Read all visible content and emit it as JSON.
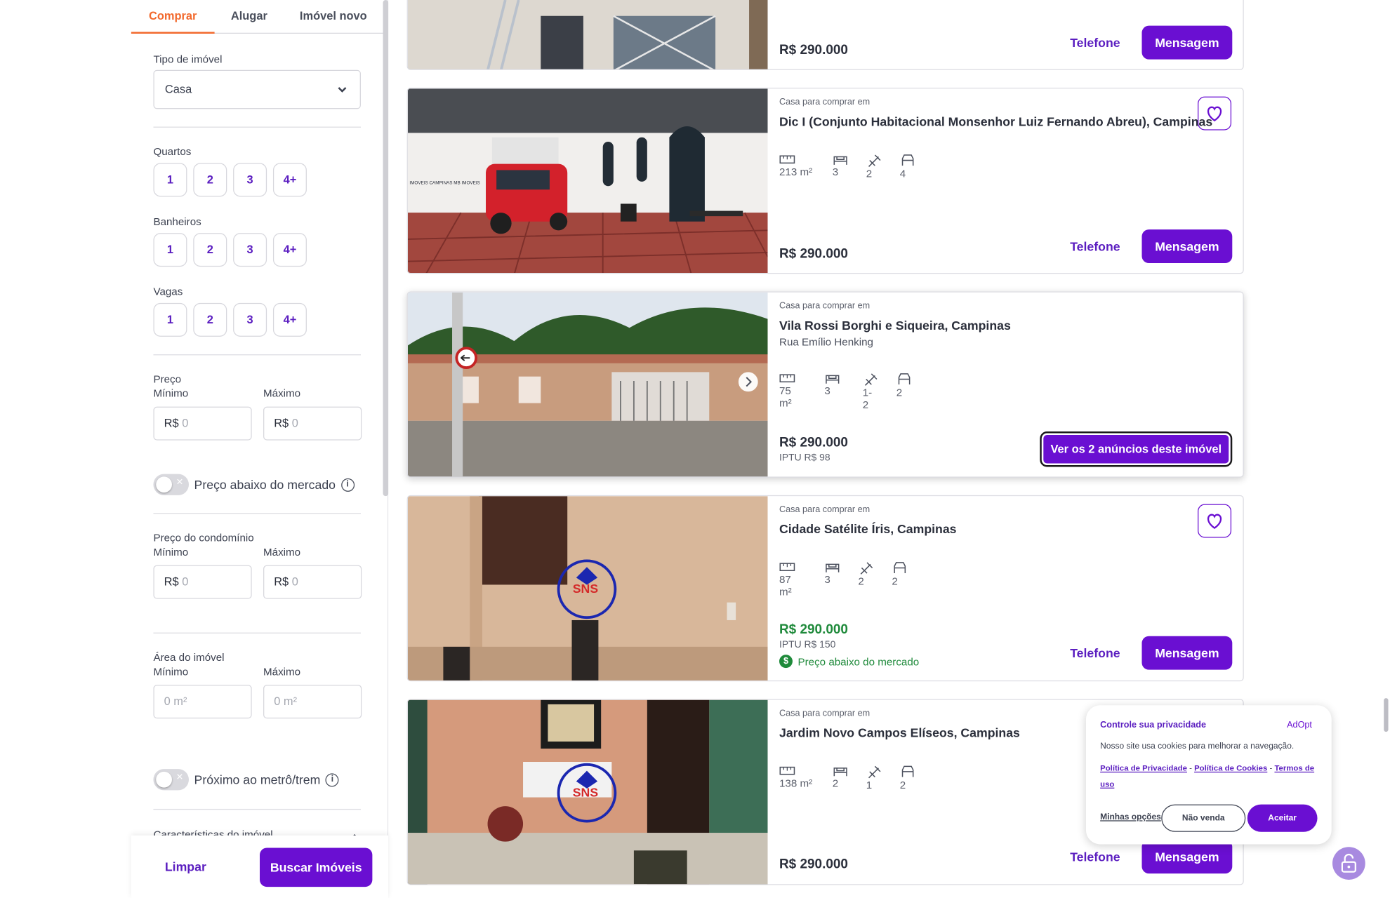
{
  "tabs": [
    {
      "label": "Comprar"
    },
    {
      "label": "Alugar"
    },
    {
      "label": "Imóvel novo"
    }
  ],
  "filters": {
    "property_type_label": "Tipo de imóvel",
    "property_type_value": "Casa",
    "bedrooms_label": "Quartos",
    "bathrooms_label": "Banheiros",
    "parking_label": "Vagas",
    "chip_options": [
      "1",
      "2",
      "3",
      "4+"
    ],
    "price_label": "Preço",
    "min_label": "Mínimo",
    "max_label": "Máximo",
    "currency_prefix": "R$",
    "price_placeholder": "0",
    "below_market_label": "Preço abaixo do mercado",
    "condo_label": "Preço do condomínio",
    "area_label": "Área do imóvel",
    "area_placeholder": "0 m²",
    "metro_label": "Próximo ao metrô/trem",
    "features_label": "Características do imóvel"
  },
  "footer": {
    "clear_label": "Limpar",
    "search_label": "Buscar Imóveis"
  },
  "listings": [
    {
      "price": "R$ 290.000",
      "phone_label": "Telefone",
      "message_label": "Mensagem"
    },
    {
      "kicker": "Casa para comprar em",
      "title": "Dic I (Conjunto Habitacional Monsenhor Luiz Fernando Abreu), Campinas",
      "area": "213 m²",
      "bedrooms": "3",
      "bathrooms": "2",
      "parking": "4",
      "price": "R$ 290.000",
      "phone_label": "Telefone",
      "message_label": "Mensagem",
      "photo_watermark": "IMOVEIS CAMPINAS MB IMOVEIS"
    },
    {
      "kicker": "Casa para comprar em",
      "title": "Vila Rossi Borghi e Siqueira, Campinas",
      "street": "Rua Emílio Henking",
      "area": "75 m²",
      "bedrooms": "3",
      "bathrooms": "1-2",
      "parking": "2",
      "price": "R$ 290.000",
      "iptu": "IPTU R$ 98",
      "cta_label": "Ver os 2 anúncios deste imóvel"
    },
    {
      "kicker": "Casa para comprar em",
      "title": "Cidade Satélite Íris, Campinas",
      "area": "87 m²",
      "bedrooms": "3",
      "bathrooms": "2",
      "parking": "2",
      "price": "R$ 290.000",
      "iptu": "IPTU R$ 150",
      "below_market": "Preço abaixo do mercado",
      "phone_label": "Telefone",
      "message_label": "Mensagem",
      "photo_logo": "SNS"
    },
    {
      "kicker": "Casa para comprar em",
      "title": "Jardim Novo Campos Elíseos, Campinas",
      "area": "138 m²",
      "bedrooms": "2",
      "bathrooms": "1",
      "parking": "2",
      "price": "R$ 290.000",
      "phone_label": "Telefone",
      "message_label": "Mensagem",
      "photo_logo": "SNS"
    }
  ],
  "cookie": {
    "title": "Controle sua privacidade",
    "brand": "AdOpt",
    "text": "Nosso site usa cookies para melhorar a navegação.",
    "privacy_link": "Política de Privacidade",
    "cookies_link": "Política de Cookies",
    "terms_link": "Termos de uso",
    "separator": "-",
    "options_label": "Minhas opções",
    "no_sell_label": "Não venda",
    "accept_label": "Aceitar"
  },
  "colors": {
    "accent": "#6a0fd2",
    "tab_active": "#f26a2e",
    "green": "#1f8a3b"
  }
}
